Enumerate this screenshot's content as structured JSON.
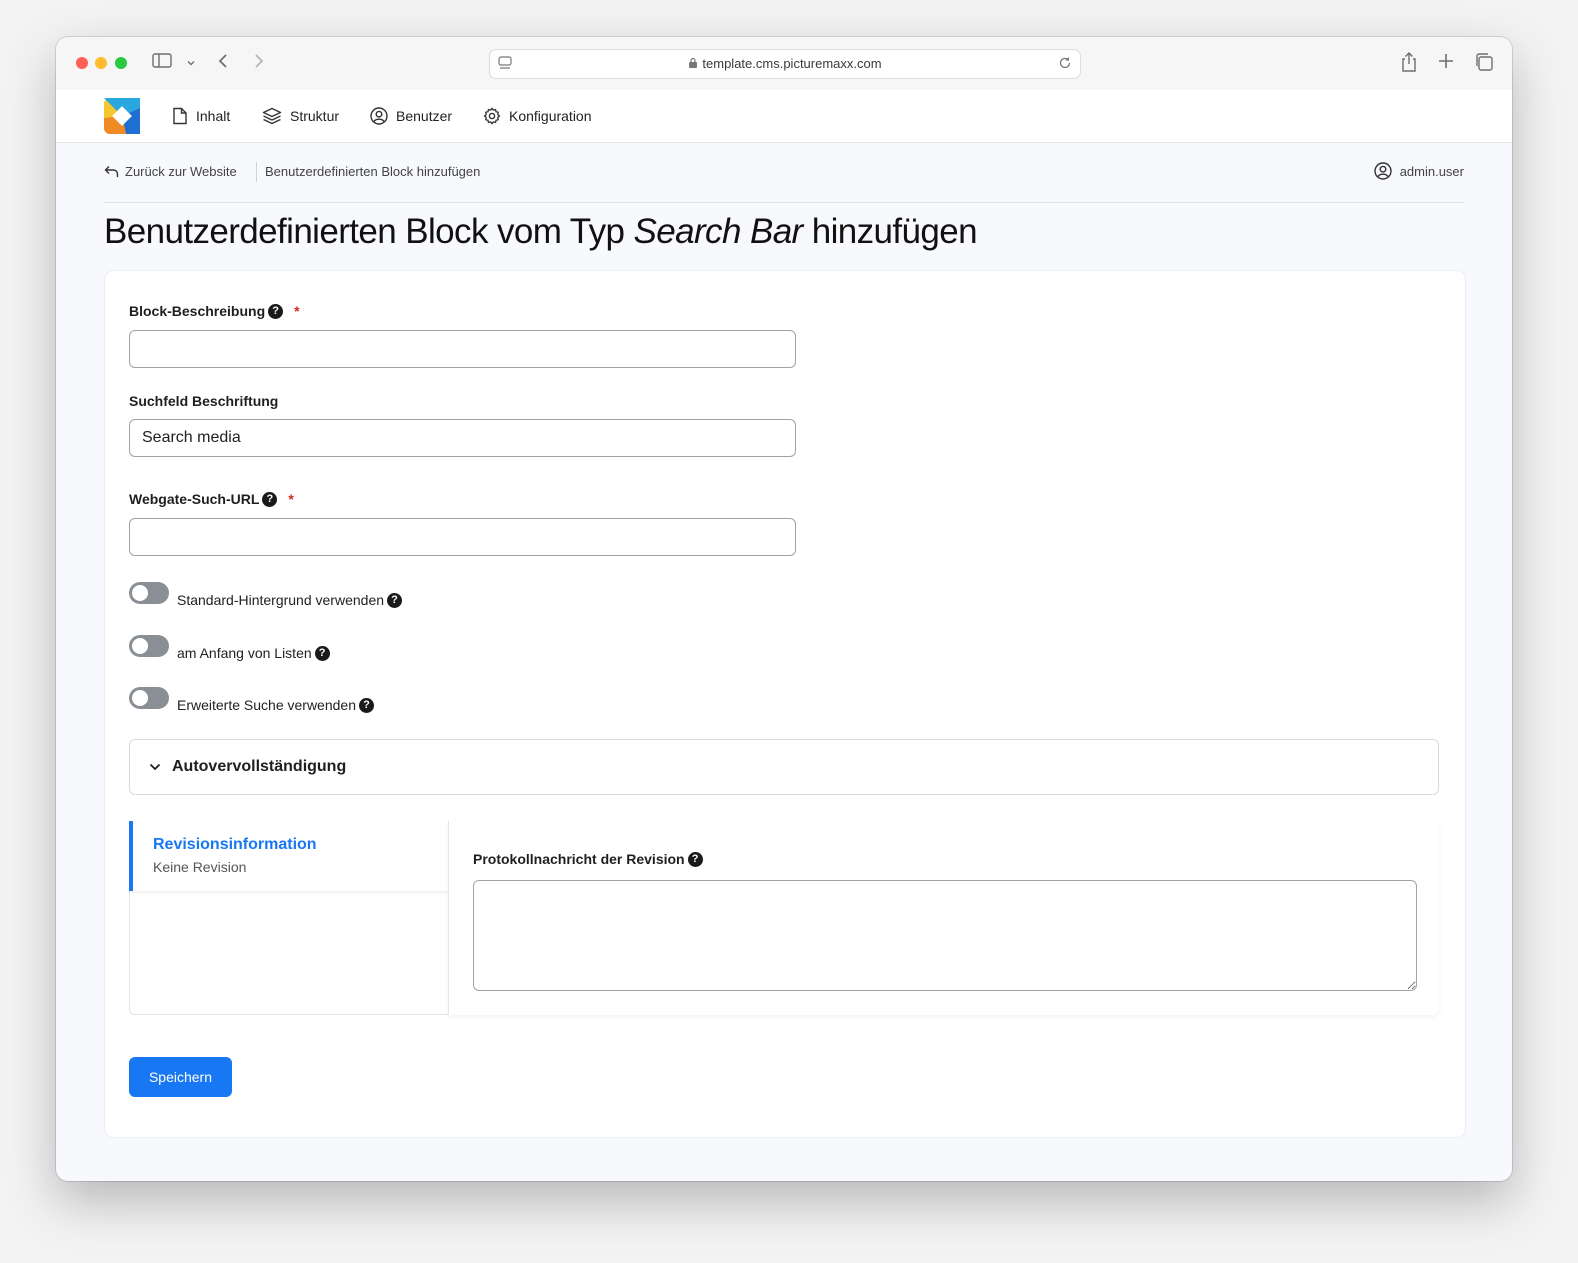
{
  "browser": {
    "url": "template.cms.picturemaxx.com"
  },
  "nav": {
    "items": [
      {
        "label": "Inhalt",
        "icon": "document-icon"
      },
      {
        "label": "Struktur",
        "icon": "layers-icon"
      },
      {
        "label": "Benutzer",
        "icon": "user-circle-icon"
      },
      {
        "label": "Konfiguration",
        "icon": "gear-icon"
      }
    ]
  },
  "breadcrumb": {
    "back_label": "Zurück zur Website",
    "current": "Benutzerdefinierten Block hinzufügen"
  },
  "user": {
    "name": "admin.user"
  },
  "page": {
    "title_prefix": "Benutzerdefinierten Block vom Typ ",
    "title_type": "Search Bar",
    "title_suffix": " hinzufügen"
  },
  "form": {
    "block_description": {
      "label": "Block-Beschreibung",
      "value": "",
      "required_mark": "*"
    },
    "search_label": {
      "label": "Suchfeld Beschriftung",
      "value": "Search media"
    },
    "webgate_url": {
      "label": "Webgate-Such-URL",
      "value": "",
      "required_mark": "*"
    },
    "toggles": [
      {
        "label": "Standard-Hintergrund verwenden",
        "checked": false
      },
      {
        "label": "am Anfang von Listen",
        "checked": false
      },
      {
        "label": "Erweiterte Suche verwenden",
        "checked": false
      }
    ],
    "autocomplete": {
      "label": "Autovervollständigung",
      "expanded": false
    },
    "revision": {
      "tab_title": "Revisionsinformation",
      "tab_subtitle": "Keine Revision",
      "log_label": "Protokollnachricht der Revision",
      "log_value": ""
    },
    "save_label": "Speichern"
  },
  "help_glyph": "?",
  "colors": {
    "accent": "#1877f2",
    "required": "#d9261c",
    "toggle_off": "#8a8f95"
  }
}
